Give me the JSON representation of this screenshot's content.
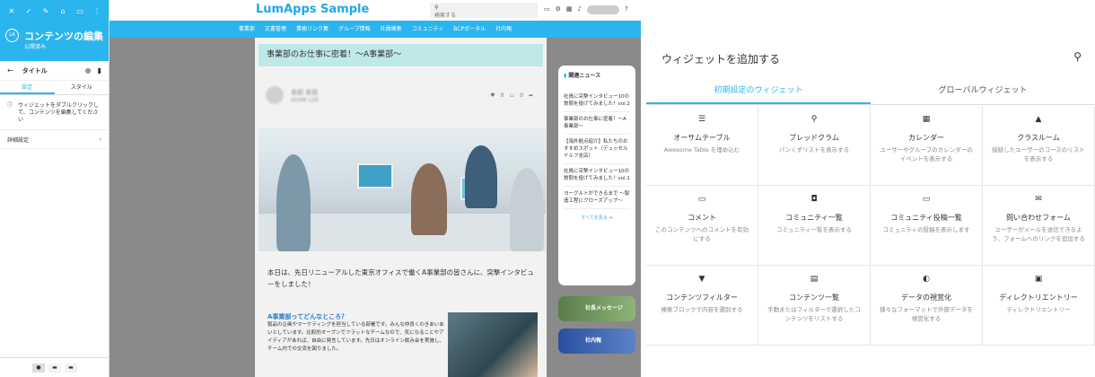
{
  "editor": {
    "title": "コンテンツの編集",
    "status": "公開済み",
    "avatar_initials": "LA",
    "widget_row_label": "タイトル",
    "tabs": [
      "設定",
      "スタイル"
    ],
    "info_text": "ウィジェットをダブルクリックして、コンテンツを編集してください",
    "advanced_label": "詳細設定",
    "toolbar_icons": [
      "close-icon",
      "check-icon",
      "edit-icon",
      "lock-icon",
      "calendar-icon",
      "more-icon"
    ]
  },
  "preview": {
    "logo": "LumApps Sample",
    "search_placeholder": "検索する",
    "nav": [
      "事業部",
      "文書管理",
      "業務リンク集",
      "グループ情報",
      "社員検索",
      "コミュニティ",
      "BCPポータル",
      "社内報"
    ],
    "article_title": "事業部のお仕事に密着！〜A事業部〜",
    "author_name": "名前 名前",
    "author_sub": "2019年 12月",
    "likes": "0",
    "comments": "0",
    "body_text": "本日は、先日リニューアルした東京オフィスで働くA事業部の皆さんに、突撃インタビューをしました！",
    "sub_heading": "A事業部ってどんなところ？",
    "sub_text": "製品の企画やマーケティングを担当している部署です。みんな仲良くわきあいあいとしています。比較的オープンでフラットなチームなので、気になることやアイディアがあれば、自由に発言しています。先日はオンライン飲み会を実施し、チーム内での交流を図りました。",
    "news_title": "関連ニュース",
    "news": [
      "社員に突撃インタビュー10の質問を投げてみました！vol.2",
      "事業部のお仕事に密着！〜A事業部〜",
      "【海外拠点紹介】私たちのおすすめスポット（デュッセルドルフ支店）",
      "社員に突撃インタビュー10の質問を投げてみました！vol.1",
      "ヨーグルトができるまで 〜製造工程にクローズアップ〜"
    ],
    "news_more": "すべてを見る",
    "banner1": "社長メッセージ",
    "banner2": "社内報"
  },
  "widgets": {
    "title": "ウィジェットを追加する",
    "tabs": [
      "初期設定のウィジェット",
      "グローバルウィジェット"
    ],
    "items": [
      {
        "icon": "list-icon",
        "glyph": "☰",
        "name": "オーサムテーブル",
        "desc": "Awesome Table を埋め込む"
      },
      {
        "icon": "location-icon",
        "glyph": "⚲",
        "name": "ブレッドクラム",
        "desc": "パンくずリストを表示する"
      },
      {
        "icon": "calendar-icon",
        "glyph": "▦",
        "name": "カレンダー",
        "desc": "ユーザーやグループのカレンダーのイベントを表示する"
      },
      {
        "icon": "school-icon",
        "glyph": "▲",
        "name": "クラスルーム",
        "desc": "接続したユーザーのコースのリストを表示する"
      },
      {
        "icon": "comment-icon",
        "glyph": "▭",
        "name": "コメント",
        "desc": "このコンテンツへのコメントを有効にする"
      },
      {
        "icon": "community-icon",
        "glyph": "◘",
        "name": "コミュニティ一覧",
        "desc": "コミュニティ一覧を表示する"
      },
      {
        "icon": "message-icon",
        "glyph": "▭",
        "name": "コミュニティ投稿一覧",
        "desc": "コミュニティの投稿を表示します"
      },
      {
        "icon": "mail-icon",
        "glyph": "✉",
        "name": "問い合わせフォーム",
        "desc": "ユーザーがメールを送信できるよう、フォームへのリンクを追加する"
      },
      {
        "icon": "filter-icon",
        "glyph": "▼",
        "name": "コンテンツフィルター",
        "desc": "検索ブロックで内容を選別する"
      },
      {
        "icon": "content-list-icon",
        "glyph": "▤",
        "name": "コンテンツ一覧",
        "desc": "手動またはフィルターで選択したコンテンツをリストする"
      },
      {
        "icon": "chart-icon",
        "glyph": "◐",
        "name": "データの視覚化",
        "desc": "様々なフォーマットで外部データを視覚化する"
      },
      {
        "icon": "directory-icon",
        "glyph": "▣",
        "name": "ディレクトリエントリー",
        "desc": "ディレクトリエントリー"
      }
    ]
  }
}
